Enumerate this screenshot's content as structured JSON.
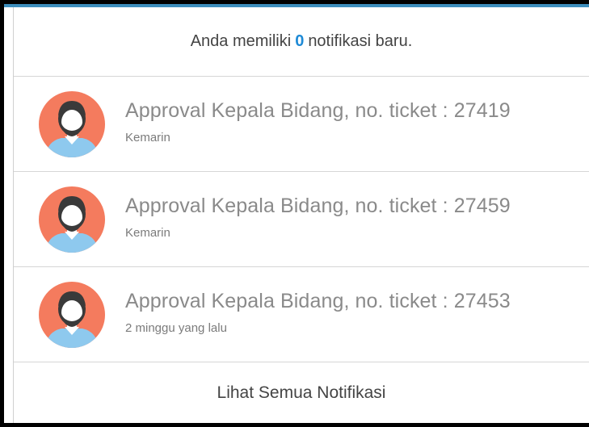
{
  "colors": {
    "accent": "#3c8dbc",
    "count_highlight": "#1e8ad6",
    "avatar_background": "#f47b5e",
    "avatar_shirt": "#8ec9ee",
    "avatar_hair": "#3a3a3a",
    "avatar_skin": "#ffffff"
  },
  "header": {
    "prefix": "Anda memiliki",
    "count": "0",
    "suffix": "notifikasi baru."
  },
  "notifications": [
    {
      "title": "Approval Kepala Bidang, no. ticket : 27419",
      "time": "Kemarin",
      "icon": "user-avatar-icon"
    },
    {
      "title": "Approval Kepala Bidang, no. ticket : 27459",
      "time": "Kemarin",
      "icon": "user-avatar-icon"
    },
    {
      "title": "Approval Kepala Bidang, no. ticket : 27453",
      "time": "2 minggu yang lalu",
      "icon": "user-avatar-icon"
    }
  ],
  "footer": {
    "label": "Lihat Semua Notifikasi"
  }
}
